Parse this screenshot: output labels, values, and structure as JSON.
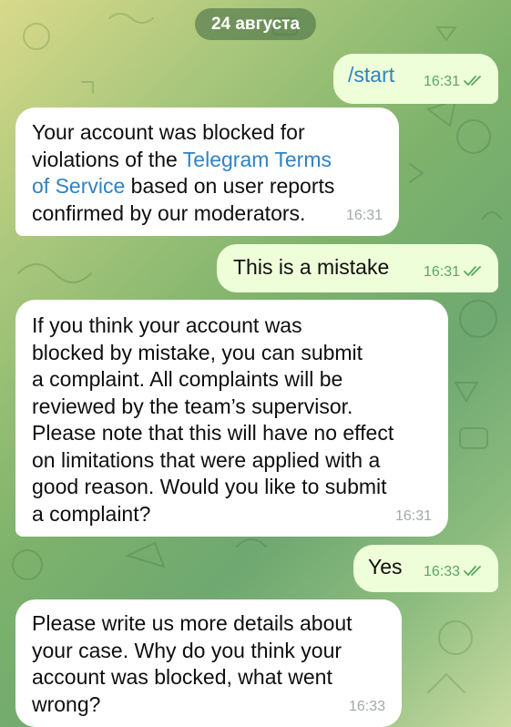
{
  "date_label": "24 августа",
  "messages": [
    {
      "id": "start",
      "direction": "outgoing",
      "command": "/start",
      "time": "16:31",
      "status": "read"
    },
    {
      "id": "blocked",
      "direction": "incoming",
      "text_before": "Your account was blocked for\nviolations of the ",
      "link": "Telegram Terms\nof Service",
      "text_after": " based on user reports\nconfirmed by our moderators.",
      "time": "16:31"
    },
    {
      "id": "mistake",
      "direction": "outgoing",
      "text": "This is a mistake",
      "time": "16:31",
      "status": "read"
    },
    {
      "id": "think",
      "direction": "incoming",
      "text": "If you think your account was\nblocked by mistake, you can submit\na complaint. All complaints will be\nreviewed by the team’s supervisor.\nPlease note that this will have no effect\non limitations that were applied with a\ngood reason. Would you like to submit\na complaint?",
      "time": "16:31"
    },
    {
      "id": "yes",
      "direction": "outgoing",
      "text": "Yes",
      "time": "16:33",
      "status": "read"
    },
    {
      "id": "details",
      "direction": "incoming",
      "text": "Please write us more details about\nyour case. Why do you think your\naccount was blocked, what went\nwrong?",
      "time": "16:33"
    }
  ],
  "colors": {
    "incoming_bubble": "#ffffff",
    "outgoing_bubble": "#eefed8",
    "link": "#2f83c4",
    "outgoing_meta": "#5aa761",
    "incoming_meta": "#a4a8ab"
  },
  "icons": {
    "read_status": "double-check-icon"
  }
}
